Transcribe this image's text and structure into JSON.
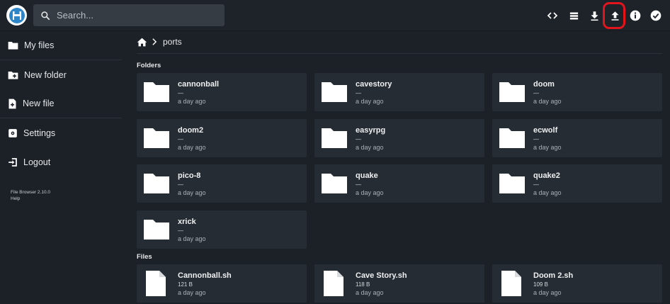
{
  "header": {
    "search_placeholder": "Search...",
    "icons": [
      "code-icon",
      "list-view-icon",
      "download-icon",
      "upload-icon",
      "info-icon",
      "check-circle-icon"
    ],
    "highlight_color": "#e3141c"
  },
  "sidebar": {
    "items": [
      {
        "label": "My files",
        "icon": "folder-icon"
      },
      {
        "label": "New folder",
        "icon": "new-folder-icon"
      },
      {
        "label": "New file",
        "icon": "new-file-icon"
      },
      {
        "label": "Settings",
        "icon": "settings-icon"
      },
      {
        "label": "Logout",
        "icon": "logout-icon"
      }
    ],
    "version": "File Browser 2.10.0",
    "help": "Help"
  },
  "breadcrumb": {
    "path": [
      "ports"
    ]
  },
  "sections": {
    "folders": "Folders",
    "files": "Files"
  },
  "folders": [
    {
      "name": "cannonball",
      "size": "—",
      "modified": "a day ago"
    },
    {
      "name": "cavestory",
      "size": "—",
      "modified": "a day ago"
    },
    {
      "name": "doom",
      "size": "—",
      "modified": "a day ago"
    },
    {
      "name": "doom2",
      "size": "—",
      "modified": "a day ago"
    },
    {
      "name": "easyrpg",
      "size": "—",
      "modified": "a day ago"
    },
    {
      "name": "ecwolf",
      "size": "—",
      "modified": "a day ago"
    },
    {
      "name": "pico-8",
      "size": "—",
      "modified": "a day ago"
    },
    {
      "name": "quake",
      "size": "—",
      "modified": "a day ago"
    },
    {
      "name": "quake2",
      "size": "—",
      "modified": "a day ago"
    },
    {
      "name": "xrick",
      "size": "—",
      "modified": "a day ago"
    }
  ],
  "files": [
    {
      "name": "Cannonball.sh",
      "size": "121 B",
      "modified": "a day ago"
    },
    {
      "name": "Cave Story.sh",
      "size": "118 B",
      "modified": "a day ago"
    },
    {
      "name": "Doom 2.sh",
      "size": "109 B",
      "modified": "a day ago"
    }
  ]
}
